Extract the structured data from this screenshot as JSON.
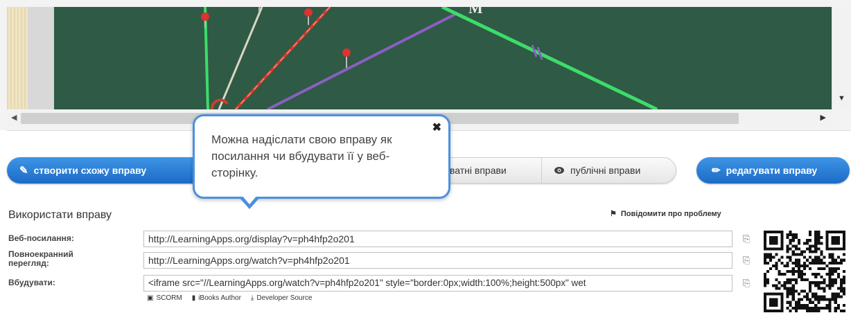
{
  "tooltip": {
    "text": "Можна надіслати свою вправу як посилання чи вбудувати її у веб-сторінку.",
    "close_icon": "close-icon"
  },
  "buttons": {
    "create_similar": "створити схожу вправу",
    "private_exercises": "ватні вправи",
    "public_exercises": "публічні вправи",
    "edit_exercise": "редагувати вправу"
  },
  "use_section": {
    "title": "Використати вправу",
    "report_problem": "Повідомити про проблему",
    "rows": [
      {
        "label": "Веб-посилання:",
        "value": "http://LearningApps.org/display?v=ph4hfp2o201"
      },
      {
        "label": "Повноекранний перегляд:",
        "value": "http://LearningApps.org/watch?v=ph4hfp2o201"
      },
      {
        "label": "Вбудувати:",
        "value": "<iframe src=\"//LearningApps.org/watch?v=ph4hfp2o201\" style=\"border:0px;width:100%;height:500px\" wet"
      }
    ],
    "exports": [
      "SCORM",
      "iBooks Author",
      "Developer Source"
    ]
  },
  "colors": {
    "board": "#2f5a45",
    "accent_blue": "#1b6bc6",
    "tooltip_border": "#4a90e2"
  }
}
